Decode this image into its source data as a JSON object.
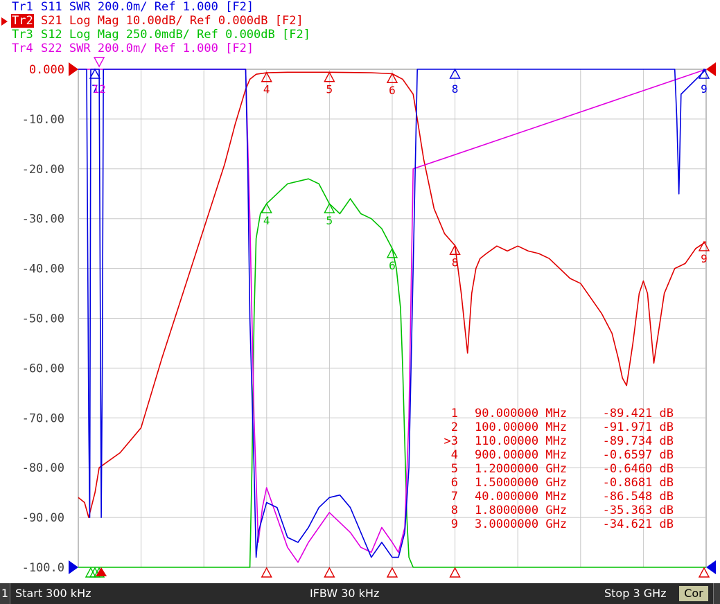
{
  "traces": [
    {
      "id": "Tr1",
      "param": "S11",
      "format": "SWR",
      "scale": "200.0m/",
      "ref": "Ref 1.000",
      "tag": "[F2]",
      "color": "#0000e0",
      "active": false
    },
    {
      "id": "Tr2",
      "param": "S21",
      "format": "Log Mag",
      "scale": "10.00dB/",
      "ref": "Ref 0.000dB",
      "tag": "[F2]",
      "color": "#e00000",
      "active": true
    },
    {
      "id": "Tr3",
      "param": "S12",
      "format": "Log Mag",
      "scale": "250.0mdB/",
      "ref": "Ref 0.000dB",
      "tag": "[F2]",
      "color": "#00c000",
      "active": false
    },
    {
      "id": "Tr4",
      "param": "S22",
      "format": "SWR",
      "scale": "200.0m/",
      "ref": "Ref 1.000",
      "tag": "[F2]",
      "color": "#e000e0",
      "active": false
    }
  ],
  "status": {
    "channel": "1",
    "start": "Start 300 kHz",
    "ifbw": "IFBW 30 kHz",
    "stop": "Stop 3 GHz",
    "cor": "Cor"
  },
  "chart_data": {
    "type": "line",
    "x_unit": "GHz",
    "xlim": [
      0.0003,
      3.0
    ],
    "ylim": [
      -100,
      0
    ],
    "y_ticks": [
      "0.000",
      "-10.00",
      "-20.00",
      "-30.00",
      "-40.00",
      "-50.00",
      "-60.00",
      "-70.00",
      "-80.00",
      "-90.00",
      "-100.0"
    ],
    "grid": true,
    "series": [
      {
        "name": "Tr2",
        "color": "#e00000",
        "x": [
          0.0003,
          0.03,
          0.05,
          0.08,
          0.1,
          0.2,
          0.3,
          0.4,
          0.5,
          0.6,
          0.7,
          0.75,
          0.8,
          0.82,
          0.85,
          0.9,
          1.0,
          1.2,
          1.4,
          1.5,
          1.55,
          1.6,
          1.62,
          1.65,
          1.7,
          1.75,
          1.8,
          1.83,
          1.86,
          1.88,
          1.9,
          1.92,
          1.95,
          2.0,
          2.05,
          2.1,
          2.15,
          2.2,
          2.25,
          2.3,
          2.35,
          2.4,
          2.45,
          2.5,
          2.55,
          2.58,
          2.6,
          2.62,
          2.65,
          2.68,
          2.7,
          2.72,
          2.75,
          2.8,
          2.85,
          2.9,
          2.95,
          3.0
        ],
        "y": [
          -86,
          -87,
          -90,
          -85,
          -80,
          -77,
          -72,
          -58,
          -45,
          -32,
          -19,
          -11,
          -4,
          -2,
          -1,
          -0.7,
          -0.6,
          -0.6,
          -0.7,
          -0.9,
          -2,
          -5,
          -10,
          -18,
          -28,
          -33,
          -35.4,
          -45,
          -57,
          -45,
          -40,
          -38,
          -37,
          -35.5,
          -36.5,
          -35.5,
          -36.5,
          -37,
          -38,
          -40,
          -42,
          -43,
          -46,
          -49,
          -53,
          -58,
          -62,
          -63.5,
          -55,
          -45,
          -42.5,
          -45,
          -59,
          -45,
          -40,
          -39,
          -36,
          -34.6
        ]
      },
      {
        "name": "Tr3",
        "color": "#00c000",
        "x": [
          0.0003,
          0.82,
          0.83,
          0.84,
          0.85,
          0.87,
          0.9,
          1.0,
          1.1,
          1.15,
          1.2,
          1.25,
          1.3,
          1.35,
          1.4,
          1.45,
          1.5,
          1.52,
          1.54,
          1.55,
          1.56,
          1.57,
          1.58,
          1.6,
          3.0
        ],
        "y": [
          -100,
          -100,
          -80,
          -50,
          -34,
          -29,
          -27,
          -23,
          -22,
          -23,
          -27,
          -29,
          -26,
          -29,
          -30,
          -32,
          -36,
          -40,
          -48,
          -60,
          -75,
          -90,
          -98,
          -100,
          -100
        ]
      },
      {
        "name": "Tr1",
        "color": "#0000e0",
        "x": [
          0.0003,
          0.04,
          0.05,
          0.055,
          0.06,
          0.1,
          0.11,
          0.115,
          0.12,
          0.8,
          0.81,
          0.82,
          0.84,
          0.85,
          0.86,
          0.88,
          0.9,
          0.95,
          1.0,
          1.05,
          1.1,
          1.15,
          1.2,
          1.25,
          1.3,
          1.35,
          1.4,
          1.45,
          1.5,
          1.53,
          1.56,
          1.58,
          1.6,
          1.62,
          2.85,
          2.86,
          2.87,
          2.88,
          3.0
        ],
        "y": [
          0,
          0,
          -70,
          -90,
          0,
          0,
          -90,
          -60,
          0,
          0,
          -20,
          -50,
          -80,
          -98,
          -93,
          -90,
          -87,
          -88,
          -94,
          -95,
          -92,
          -88,
          -86,
          -85.5,
          -88,
          -93,
          -98,
          -95,
          -98,
          -98,
          -93,
          -80,
          -40,
          0,
          0,
          -10,
          -25,
          -5,
          0
        ]
      },
      {
        "name": "Tr4",
        "color": "#e000e0",
        "x": [
          0.0003,
          0.8,
          0.82,
          0.84,
          0.86,
          0.88,
          0.9,
          0.95,
          1.0,
          1.05,
          1.1,
          1.15,
          1.2,
          1.25,
          1.3,
          1.35,
          1.4,
          1.45,
          1.5,
          1.53,
          1.56,
          1.58,
          1.6,
          3.0
        ],
        "y": [
          0,
          0,
          -30,
          -70,
          -95,
          -88,
          -84,
          -90,
          -96,
          -99,
          -95,
          -92,
          -89,
          -91,
          -93,
          -96,
          -97,
          -92,
          -95,
          -97,
          -92,
          -70,
          -20,
          0
        ]
      }
    ],
    "marker_table": [
      {
        "label": "1",
        "freq": "90.000000 MHz",
        "value": "-89.421 dB",
        "active": false
      },
      {
        "label": "2",
        "freq": "100.00000 MHz",
        "value": "-91.971 dB",
        "active": false
      },
      {
        "label": ">3",
        "freq": "110.00000 MHz",
        "value": "-89.734 dB",
        "active": true
      },
      {
        "label": "4",
        "freq": "900.00000 MHz",
        "value": "-0.6597 dB",
        "active": false
      },
      {
        "label": "5",
        "freq": "1.2000000 GHz",
        "value": "-0.6460 dB",
        "active": false
      },
      {
        "label": "6",
        "freq": "1.5000000 GHz",
        "value": "-0.8681 dB",
        "active": false
      },
      {
        "label": "7",
        "freq": "40.000000 MHz",
        "value": "-86.548 dB",
        "active": false
      },
      {
        "label": "8",
        "freq": "1.8000000 GHz",
        "value": "-35.363 dB",
        "active": false
      },
      {
        "label": "9",
        "freq": "3.0000000 GHz",
        "value": "-34.621 dB",
        "active": false
      }
    ],
    "red_markers": [
      {
        "label": "4",
        "x": 0.9,
        "y": -0.6597
      },
      {
        "label": "5",
        "x": 1.2,
        "y": -0.646
      },
      {
        "label": "6",
        "x": 1.5,
        "y": -0.8681
      },
      {
        "label": "8",
        "x": 1.8,
        "y": -35.363
      },
      {
        "label": "9",
        "x": 3.0,
        "y": -34.621
      }
    ],
    "blue_markers": [
      {
        "label": "7",
        "x": 0.04
      },
      {
        "label": "8",
        "x": 1.8
      },
      {
        "label": "9",
        "x": 3.0
      }
    ],
    "green_markers": [
      {
        "label": "4",
        "x": 0.9,
        "y": -27
      },
      {
        "label": "5",
        "x": 1.2,
        "y": -27
      },
      {
        "label": "6",
        "x": 1.5,
        "y": -36
      }
    ]
  }
}
